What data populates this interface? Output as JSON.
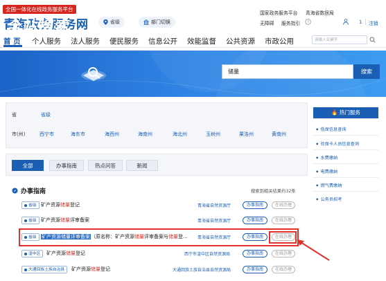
{
  "header": {
    "slogan": "全国一体化在线政务服务平台",
    "title": "青海政务服务网",
    "region_label": "省级",
    "dept_switch_label": "部门切换",
    "national_platform": "国家政务服务平台",
    "province_data": "青海省数据局",
    "accessibility": "无障碍",
    "service_guide": "服务指引",
    "counter": "1",
    "logout": "注销"
  },
  "nav": {
    "items": [
      "首 页",
      "个人服务",
      "法人服务",
      "便民服务",
      "信息公开",
      "效能监督",
      "公共资源",
      "市政公用"
    ],
    "active_index": 0,
    "search_placeholder": "请输入关键字"
  },
  "banner": {
    "title": "全站搜索",
    "search_value": "储量",
    "search_button": "搜索"
  },
  "filter": {
    "province_label": "省",
    "province_value": "省级",
    "city_label": "市(州)",
    "cities": [
      "西宁市",
      "海东市",
      "海西州",
      "海南州",
      "海北州",
      "玉树州",
      "果洛州",
      "黄南州"
    ]
  },
  "tabs": {
    "items": [
      "全部",
      "办事指南",
      "热点问答",
      "新闻"
    ],
    "active_index": 0
  },
  "results": {
    "section_title": "办事指南",
    "count_text": "搜索到相关结果约32条",
    "rows": [
      {
        "level": "省级",
        "name_pre": "矿产资源",
        "name_hl": "储量",
        "name_post": "登记",
        "dept": "青海省自然资源厅",
        "guide": "办事指南",
        "online": "在线办理"
      },
      {
        "level": "省级",
        "name_pre": "矿产资源",
        "name_hl": "储量",
        "name_post": "评审备案",
        "dept": "青海省自然资源厅",
        "guide": "办事指南",
        "online": "在线办理"
      },
      {
        "level": "省级",
        "name_selected": "矿产资源储量评审备案",
        "name_rest_pre": "（原名称：矿产资源",
        "name_rest_hl": "储量",
        "name_rest_mid": "评审备案与",
        "name_rest_hl2": "储量",
        "name_rest_post": "登...",
        "dept": "青海省自然资源厅",
        "guide": "办事指南",
        "online": "在线办理"
      },
      {
        "level": "湟中区",
        "name_pre": "矿产资源",
        "name_hl": "储量",
        "name_post": "登记",
        "dept": "西宁市湟中区自然资源局",
        "guide": "办事指南",
        "online": "在线办理"
      },
      {
        "level": "大通回族土族自治县",
        "name_pre": "矿产资源",
        "name_hl": "储量",
        "name_post": "登记",
        "dept": "大通回族土族自治县自然资源局",
        "guide": "办事指南",
        "online": "在线办理"
      }
    ]
  },
  "sidebar": {
    "hot_title": "热门服务",
    "items": [
      "低保信息查询",
      "社保卡人员信息查询",
      "水费缴纳",
      "电费缴纳",
      "燃气费缴纳",
      "公务员招考"
    ]
  },
  "colors": {
    "primary": "#1a5fb4",
    "highlight_red": "#e0312b",
    "slogan_bg": "#d7261e"
  }
}
